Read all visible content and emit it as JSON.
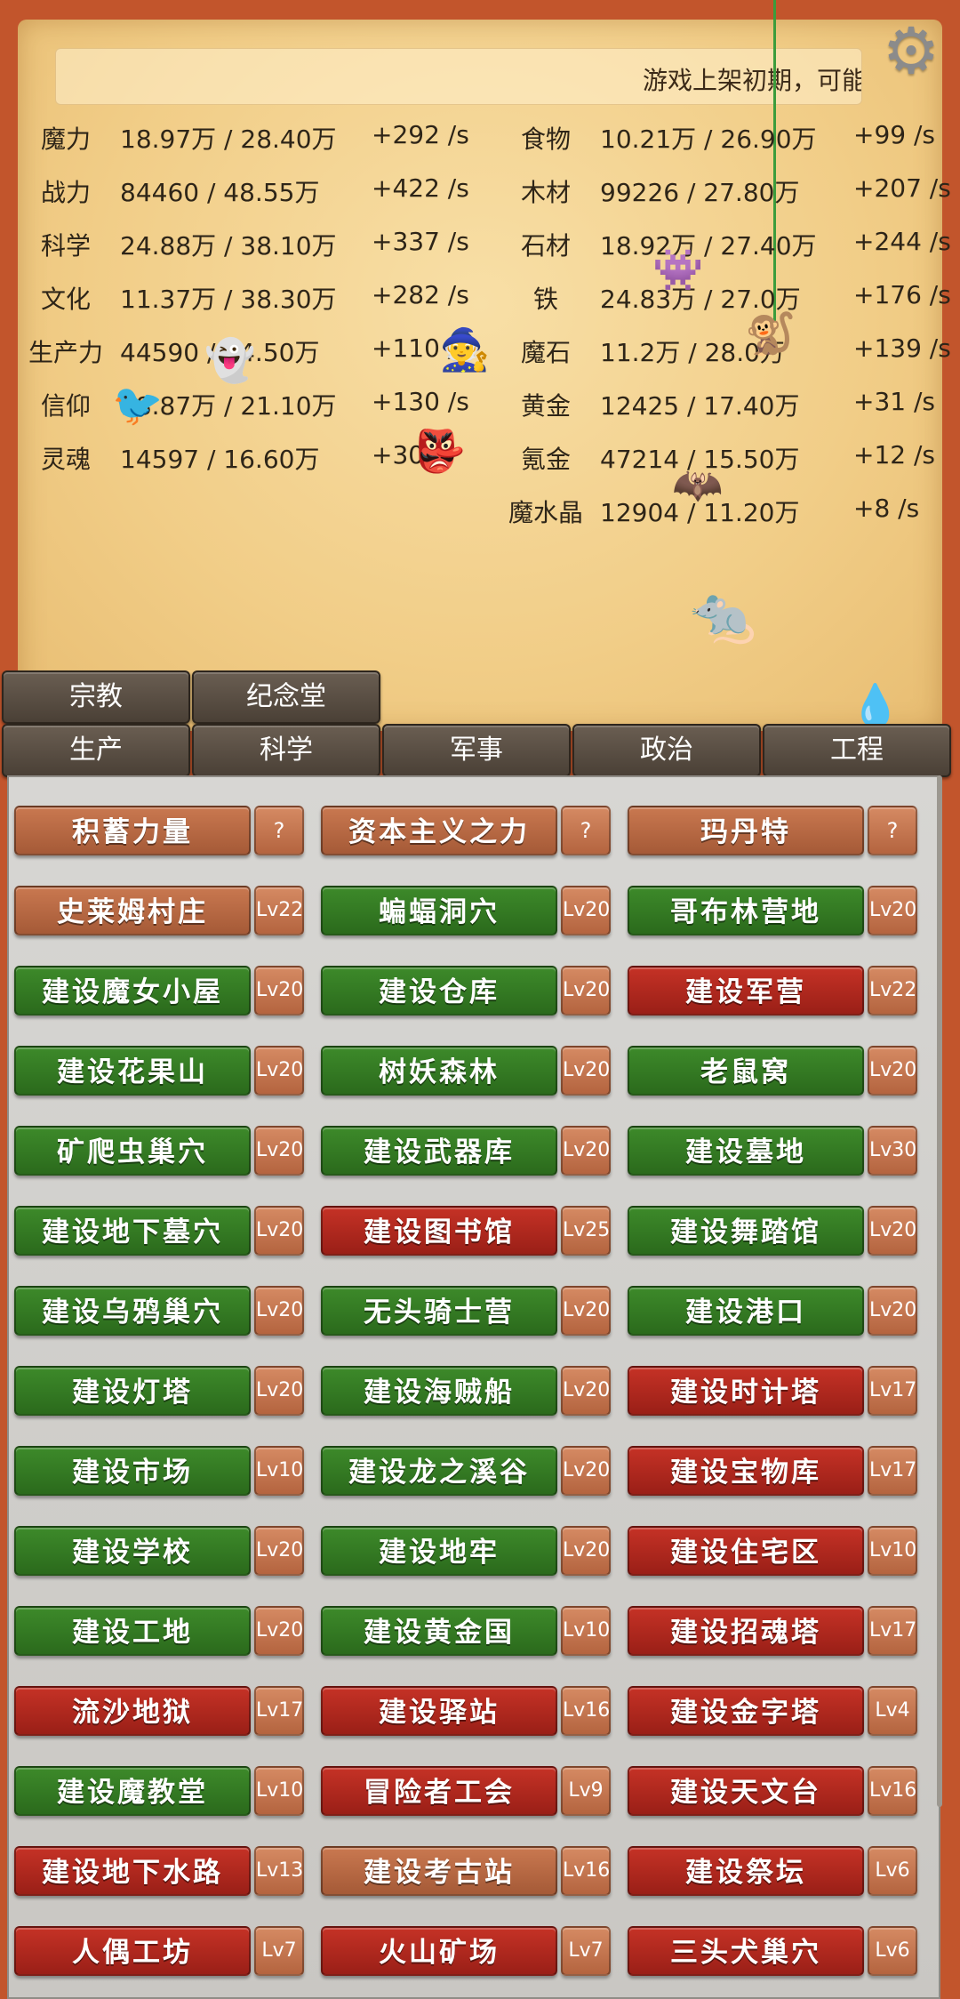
{
  "notice": "游戏上架初期，可能",
  "resources_left": [
    {
      "name": "魔力",
      "value": "18.97万 / 28.40万",
      "rate": "+292 /s"
    },
    {
      "name": "战力",
      "value": "84460 / 48.55万",
      "rate": "+422 /s"
    },
    {
      "name": "科学",
      "value": "24.88万 / 38.10万",
      "rate": "+337 /s"
    },
    {
      "name": "文化",
      "value": "11.37万 / 38.30万",
      "rate": "+282 /s"
    },
    {
      "name": "生产力",
      "value": "44590 / 14.50万",
      "rate": "+110 /s"
    },
    {
      "name": "信仰",
      "value": "18.87万 / 21.10万",
      "rate": "+130 /s"
    },
    {
      "name": "灵魂",
      "value": "14597 / 16.60万",
      "rate": "+30 /s"
    }
  ],
  "resources_right": [
    {
      "name": "食物",
      "value": "10.21万 / 26.90万",
      "rate": "+99 /s"
    },
    {
      "name": "木材",
      "value": "99226 / 27.80万",
      "rate": "+207 /s"
    },
    {
      "name": "石材",
      "value": "18.92万 / 27.40万",
      "rate": "+244 /s"
    },
    {
      "name": "铁",
      "value": "24.83万 / 27.0万",
      "rate": "+176 /s"
    },
    {
      "name": "魔石",
      "value": "11.2万 / 28.0万",
      "rate": "+139 /s"
    },
    {
      "name": "黄金",
      "value": "12425 / 17.40万",
      "rate": "+31 /s"
    },
    {
      "name": "氪金",
      "value": "47214 / 15.50万",
      "rate": "+12 /s"
    },
    {
      "name": "魔水晶",
      "value": "12904 / 11.20万",
      "rate": "+8 /s"
    }
  ],
  "tabs_top": [
    "宗教",
    "纪念堂"
  ],
  "tabs_main": [
    "生产",
    "科学",
    "军事",
    "政治",
    "工程"
  ],
  "buildings": [
    [
      {
        "label": "积蓄力量",
        "tag": "?",
        "color": "brown"
      },
      {
        "label": "资本主义之力",
        "tag": "?",
        "color": "brown"
      },
      {
        "label": "玛丹特",
        "tag": "?",
        "color": "brown"
      }
    ],
    [
      {
        "label": "史莱姆村庄",
        "tag": "Lv22",
        "color": "brown"
      },
      {
        "label": "蝙蝠洞穴",
        "tag": "Lv20",
        "color": "green"
      },
      {
        "label": "哥布林营地",
        "tag": "Lv20",
        "color": "green"
      }
    ],
    [
      {
        "label": "建设魔女小屋",
        "tag": "Lv20",
        "color": "green"
      },
      {
        "label": "建设仓库",
        "tag": "Lv20",
        "color": "green"
      },
      {
        "label": "建设军营",
        "tag": "Lv22",
        "color": "red"
      }
    ],
    [
      {
        "label": "建设花果山",
        "tag": "Lv20",
        "color": "green"
      },
      {
        "label": "树妖森林",
        "tag": "Lv20",
        "color": "green"
      },
      {
        "label": "老鼠窝",
        "tag": "Lv20",
        "color": "green"
      }
    ],
    [
      {
        "label": "矿爬虫巢穴",
        "tag": "Lv20",
        "color": "green"
      },
      {
        "label": "建设武器库",
        "tag": "Lv20",
        "color": "green"
      },
      {
        "label": "建设墓地",
        "tag": "Lv30",
        "color": "green"
      }
    ],
    [
      {
        "label": "建设地下墓穴",
        "tag": "Lv20",
        "color": "green"
      },
      {
        "label": "建设图书馆",
        "tag": "Lv25",
        "color": "red"
      },
      {
        "label": "建设舞踏馆",
        "tag": "Lv20",
        "color": "green"
      }
    ],
    [
      {
        "label": "建设乌鸦巢穴",
        "tag": "Lv20",
        "color": "green"
      },
      {
        "label": "无头骑士营",
        "tag": "Lv20",
        "color": "green"
      },
      {
        "label": "建设港口",
        "tag": "Lv20",
        "color": "green"
      }
    ],
    [
      {
        "label": "建设灯塔",
        "tag": "Lv20",
        "color": "green"
      },
      {
        "label": "建设海贼船",
        "tag": "Lv20",
        "color": "green"
      },
      {
        "label": "建设时计塔",
        "tag": "Lv17",
        "color": "red"
      }
    ],
    [
      {
        "label": "建设市场",
        "tag": "Lv10",
        "color": "green"
      },
      {
        "label": "建设龙之溪谷",
        "tag": "Lv20",
        "color": "green"
      },
      {
        "label": "建设宝物库",
        "tag": "Lv17",
        "color": "red"
      }
    ],
    [
      {
        "label": "建设学校",
        "tag": "Lv20",
        "color": "green"
      },
      {
        "label": "建设地牢",
        "tag": "Lv20",
        "color": "green"
      },
      {
        "label": "建设住宅区",
        "tag": "Lv10",
        "color": "red"
      }
    ],
    [
      {
        "label": "建设工地",
        "tag": "Lv20",
        "color": "green"
      },
      {
        "label": "建设黄金国",
        "tag": "Lv10",
        "color": "green"
      },
      {
        "label": "建设招魂塔",
        "tag": "Lv17",
        "color": "red"
      }
    ],
    [
      {
        "label": "流沙地狱",
        "tag": "Lv17",
        "color": "red"
      },
      {
        "label": "建设驿站",
        "tag": "Lv16",
        "color": "red"
      },
      {
        "label": "建设金字塔",
        "tag": "Lv4",
        "color": "red"
      }
    ],
    [
      {
        "label": "建设魔教堂",
        "tag": "Lv10",
        "color": "green"
      },
      {
        "label": "冒险者工会",
        "tag": "Lv9",
        "color": "red"
      },
      {
        "label": "建设天文台",
        "tag": "Lv16",
        "color": "red"
      }
    ],
    [
      {
        "label": "建设地下水路",
        "tag": "Lv13",
        "color": "red"
      },
      {
        "label": "建设考古站",
        "tag": "Lv16",
        "color": "brown"
      },
      {
        "label": "建设祭坛",
        "tag": "Lv6",
        "color": "red"
      }
    ],
    [
      {
        "label": "人偶工坊",
        "tag": "Lv7",
        "color": "red"
      },
      {
        "label": "火山矿场",
        "tag": "Lv7",
        "color": "red"
      },
      {
        "label": "三头犬巢穴",
        "tag": "Lv6",
        "color": "red"
      }
    ]
  ]
}
